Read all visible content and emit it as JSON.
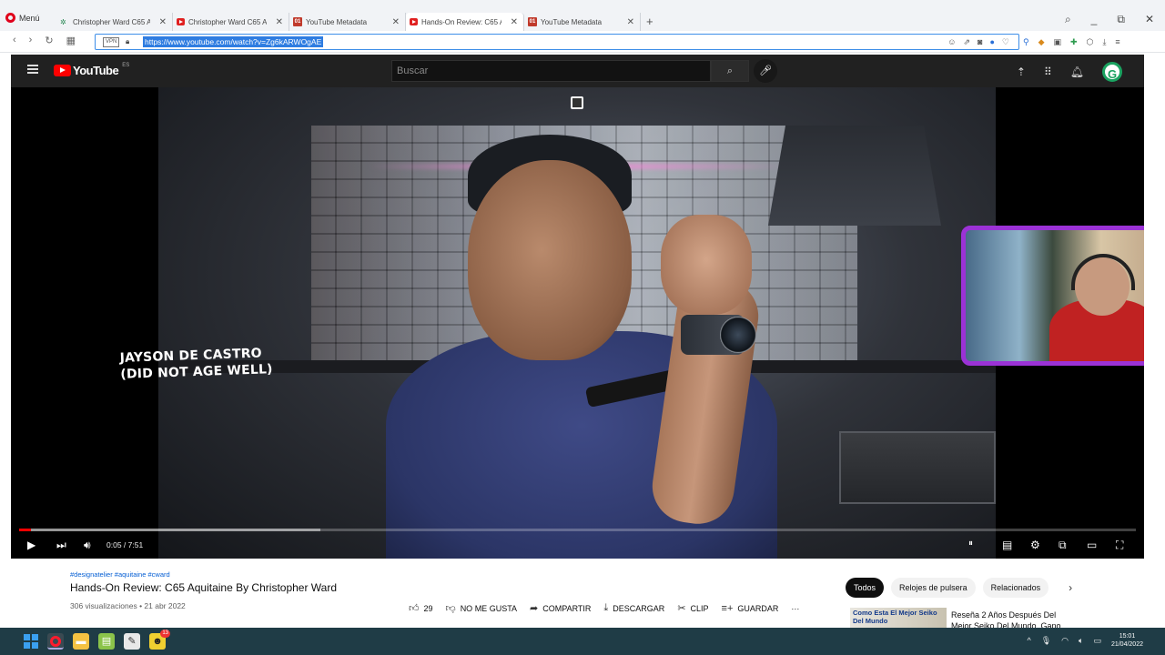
{
  "browser": {
    "menu_label": "Menú",
    "tabs": [
      {
        "title": "Christopher Ward C65 Aqu",
        "icon": "insect-icon"
      },
      {
        "title": "Christopher Ward C65 Aqu",
        "icon": "youtube-icon"
      },
      {
        "title": "YouTube Metadata",
        "icon": "metadata-icon"
      },
      {
        "title": "Hands-On Review: C65 Aqu",
        "icon": "youtube-icon",
        "active": true
      },
      {
        "title": "YouTube Metadata",
        "icon": "metadata-icon"
      }
    ],
    "new_tab": "+",
    "address": {
      "vpn_label": "VPN",
      "url": "https://www.youtube.com/watch?v=Zg6kARWOgAE"
    }
  },
  "youtube": {
    "logo_text": "YouTube",
    "country": "ES",
    "search_placeholder": "Buscar",
    "avatar_letter": "G"
  },
  "player": {
    "overlay_line1": "JAYSON DE CASTRO",
    "overlay_line2": "(DID NOT AGE WELL)",
    "time_label": "0:05 / 7:51",
    "played_fraction": 0.011,
    "buffered_fraction": 0.27
  },
  "video": {
    "hashtags": "#designatelier #aquitaine #cward",
    "title": "Hands-On Review: C65 Aquitaine By Christopher Ward",
    "stats": "306 visualizaciones • 21 abr 2022",
    "likes": "29",
    "dislike_label": "NO ME GUSTA",
    "share_label": "COMPARTIR",
    "download_label": "DESCARGAR",
    "clip_label": "CLIP",
    "save_label": "GUARDAR",
    "more_label": "···"
  },
  "sidebar": {
    "chips": [
      "Todos",
      "Relojes de pulsera",
      "Relacionados"
    ],
    "next_label": "›",
    "rec": {
      "thumb_text": "Como Esta El Mejor Seiko Del Mundo",
      "title": "Reseña 2 Años Después Del Mejor Seiko Del Mundo. Gano"
    }
  },
  "taskbar": {
    "time": "15:01",
    "date": "21/04/2022",
    "badge": "13"
  },
  "colors": {
    "yt_red": "#ff0000",
    "pip_border": "#9b32d6",
    "url_highlight": "#2f7de1",
    "taskbar": "#1f3c46"
  }
}
